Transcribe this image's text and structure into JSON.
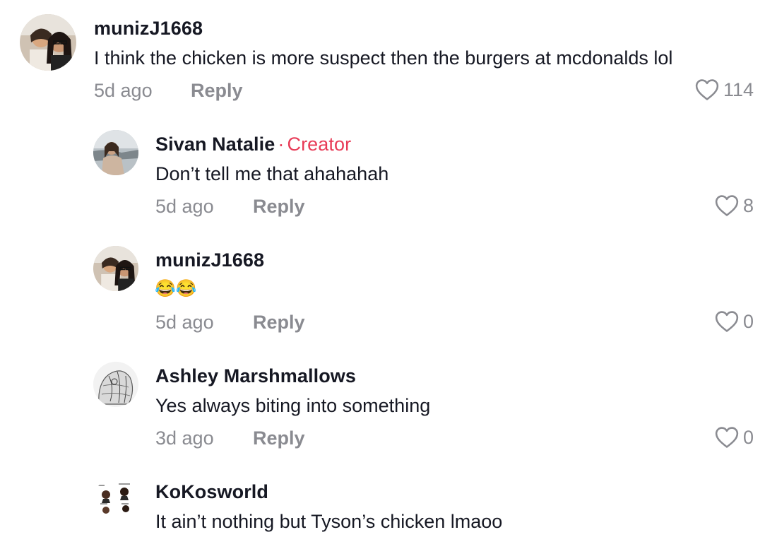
{
  "comments": [
    {
      "username": "munizJ1668",
      "text": "I think the chicken is more suspect then the burgers at mcdonalds lol",
      "time": "5d ago",
      "reply_label": "Reply",
      "likes": "114",
      "avatar_icon": "user-photo-two-women"
    },
    {
      "username": "Sivan Natalie",
      "creator_separator": "·",
      "creator_badge": "Creator",
      "text": "Don’t tell me that ahahahah",
      "time": "5d ago",
      "reply_label": "Reply",
      "likes": "8",
      "avatar_icon": "user-photo-woman-beach"
    },
    {
      "username": "munizJ1668",
      "text": "😂😂",
      "time": "5d ago",
      "reply_label": "Reply",
      "likes": "0",
      "avatar_icon": "user-photo-two-women"
    },
    {
      "username": "Ashley Marshmallows",
      "text": "Yes always biting into something",
      "time": "3d ago",
      "reply_label": "Reply",
      "likes": "0",
      "avatar_icon": "user-photo-sketch"
    },
    {
      "username": "KoKosworld",
      "text": "It ain’t nothing but Tyson’s chicken lmaoo",
      "avatar_icon": "user-photo-grid-illustration"
    }
  ],
  "colors": {
    "creator_accent": "#e83b57",
    "secondary_text": "#8a8b91",
    "primary_text": "#161823"
  },
  "icons": {
    "like": "heart-outline-icon"
  }
}
